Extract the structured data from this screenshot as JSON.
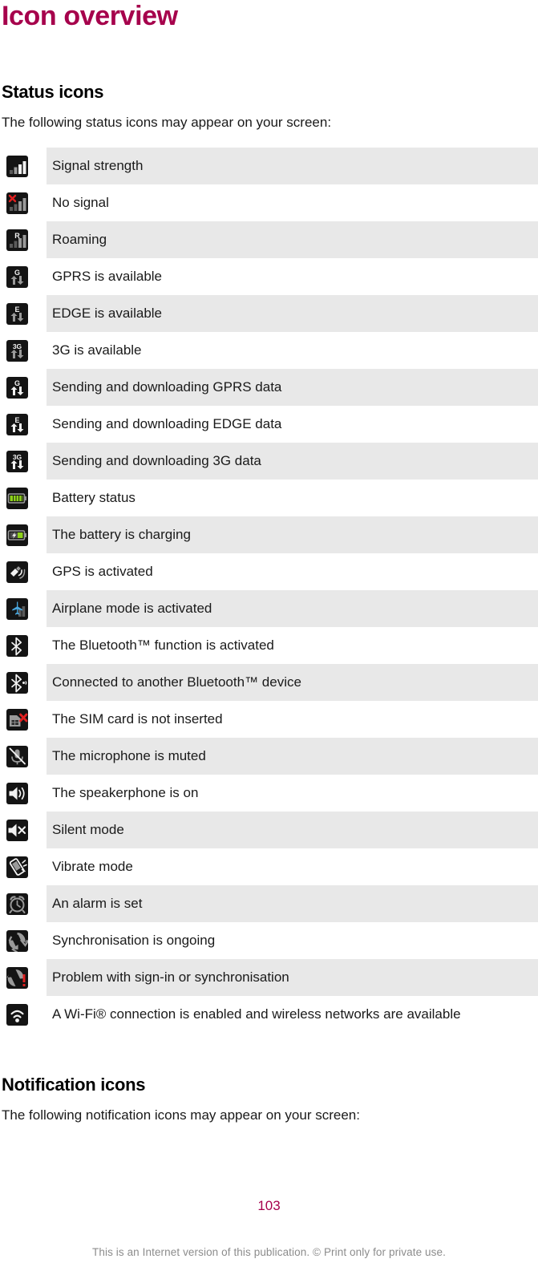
{
  "document": {
    "title": "Icon overview",
    "title_color": "#A6004C"
  },
  "status_section": {
    "heading": "Status icons",
    "intro": "The following status icons may appear on your screen:",
    "rows": [
      {
        "icon": "signal-strength-icon",
        "label": "Signal strength"
      },
      {
        "icon": "no-signal-icon",
        "label": "No signal"
      },
      {
        "icon": "roaming-icon",
        "label": "Roaming"
      },
      {
        "icon": "gprs-available-icon",
        "label": "GPRS is available"
      },
      {
        "icon": "edge-available-icon",
        "label": "EDGE is available"
      },
      {
        "icon": "3g-available-icon",
        "label": "3G is available"
      },
      {
        "icon": "gprs-data-transfer-icon",
        "label": "Sending and downloading GPRS data"
      },
      {
        "icon": "edge-data-transfer-icon",
        "label": "Sending and downloading EDGE data"
      },
      {
        "icon": "3g-data-transfer-icon",
        "label": "Sending and downloading 3G data"
      },
      {
        "icon": "battery-status-icon",
        "label": "Battery status"
      },
      {
        "icon": "battery-charging-icon",
        "label": "The battery is charging"
      },
      {
        "icon": "gps-activated-icon",
        "label": "GPS is activated"
      },
      {
        "icon": "airplane-mode-icon",
        "label": "Airplane mode is activated"
      },
      {
        "icon": "bluetooth-activated-icon",
        "label": "The Bluetooth™ function is activated"
      },
      {
        "icon": "bluetooth-connected-icon",
        "label": "Connected to another Bluetooth™ device"
      },
      {
        "icon": "sim-card-missing-icon",
        "label": "The SIM card is not inserted"
      },
      {
        "icon": "microphone-muted-icon",
        "label": "The microphone is muted"
      },
      {
        "icon": "speakerphone-on-icon",
        "label": "The speakerphone is on"
      },
      {
        "icon": "silent-mode-icon",
        "label": "Silent mode"
      },
      {
        "icon": "vibrate-mode-icon",
        "label": "Vibrate mode"
      },
      {
        "icon": "alarm-set-icon",
        "label": "An alarm is set"
      },
      {
        "icon": "sync-ongoing-icon",
        "label": "Synchronisation is ongoing"
      },
      {
        "icon": "sync-problem-icon",
        "label": "Problem with sign-in or synchronisation"
      },
      {
        "icon": "wifi-connection-icon",
        "label": "A Wi-Fi® connection is enabled and wireless networks are available"
      }
    ]
  },
  "notification_section": {
    "heading": "Notification icons",
    "intro": "The following notification icons may appear on your screen:"
  },
  "footer": {
    "page_number": "103",
    "note": "This is an Internet version of this publication. © Print only for private use.",
    "note_color": "#8c8c8c"
  }
}
